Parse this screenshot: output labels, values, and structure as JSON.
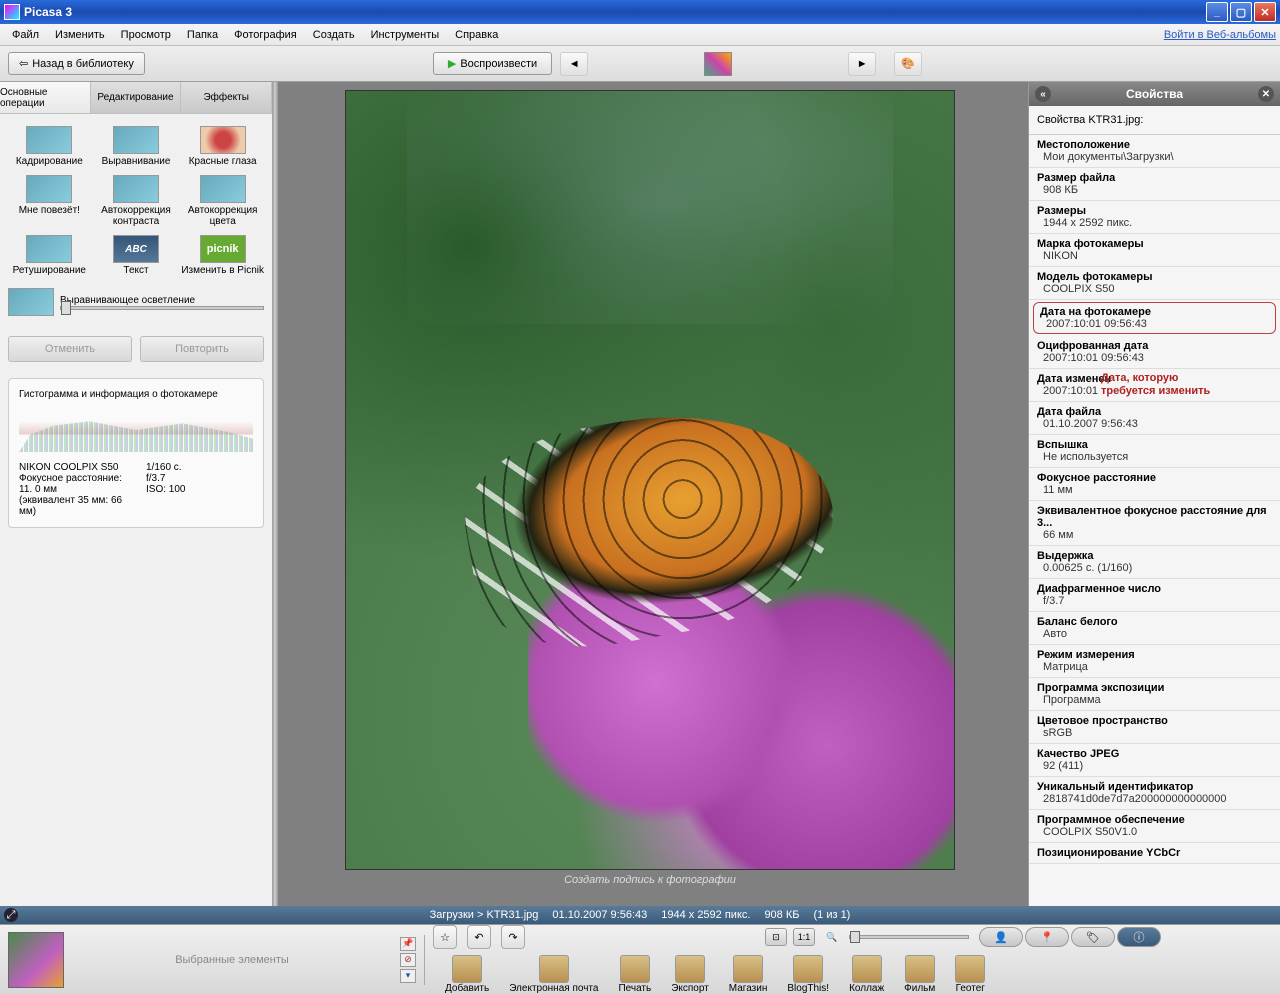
{
  "window": {
    "title": "Picasa 3"
  },
  "menu": {
    "items": [
      "Файл",
      "Изменить",
      "Просмотр",
      "Папка",
      "Фотография",
      "Создать",
      "Инструменты",
      "Справка"
    ],
    "login": "Войти в Веб-альбомы"
  },
  "toolbar": {
    "back": "Назад в библиотеку",
    "play": "Воспроизвести"
  },
  "tabs": {
    "basic": "Основные операции",
    "edit": "Редактирование",
    "effects": "Эффекты"
  },
  "tools": [
    "Кадрирование",
    "Выравнивание",
    "Красные глаза",
    "Мне повезёт!",
    "Автокоррекция контраста",
    "Автокоррекция цвета",
    "Ретуширование",
    "Текст",
    "Изменить в Picnik"
  ],
  "fill_light": "Выравнивающее осветление",
  "actions": {
    "undo": "Отменить",
    "redo": "Повторить"
  },
  "histogram": {
    "title": "Гистограмма и информация о фотокамере",
    "camera": "NIKON COOLPIX S50",
    "focal": "Фокусное расстояние: 11. 0 мм",
    "equiv": "(эквивалент 35 мм:  66 мм)",
    "shutter": "1/160 с.",
    "aperture": "f/3.7",
    "iso": "ISO: 100"
  },
  "caption_hint": "Создать подпись к фотографии",
  "properties": {
    "title": "Свойства",
    "subheader": "Свойства KTR31.jpg:",
    "items": [
      {
        "k": "Местоположение",
        "v": "Мои документы\\Загрузки\\"
      },
      {
        "k": "Размер файла",
        "v": "908 КБ"
      },
      {
        "k": "Размеры",
        "v": "1944 x 2592 пикс."
      },
      {
        "k": "Марка фотокамеры",
        "v": "NIKON"
      },
      {
        "k": "Модель фотокамеры",
        "v": "COOLPIX S50"
      },
      {
        "k": "Дата на фотокамере",
        "v": "2007:10:01 09:56:43",
        "hl": true
      },
      {
        "k": "Оцифрованная дата",
        "v": "2007:10:01 09:56:43"
      },
      {
        "k": "Дата изменен",
        "v": "2007:10:01"
      },
      {
        "k": "Дата файла",
        "v": "01.10.2007 9:56:43"
      },
      {
        "k": "Вспышка",
        "v": "Не используется"
      },
      {
        "k": "Фокусное расстояние",
        "v": "11 мм"
      },
      {
        "k": "Эквивалентное фокусное расстояние для 3...",
        "v": "66 мм"
      },
      {
        "k": "Выдержка",
        "v": "0.00625 с.  (1/160)"
      },
      {
        "k": "Диафрагменное число",
        "v": "f/3.7"
      },
      {
        "k": "Баланс белого",
        "v": "Авто"
      },
      {
        "k": "Режим измерения",
        "v": "Матрица"
      },
      {
        "k": "Программа экспозиции",
        "v": "Программа"
      },
      {
        "k": "Цветовое пространство",
        "v": "sRGB"
      },
      {
        "k": "Качество JPEG",
        "v": "92 (411)"
      },
      {
        "k": "Уникальный идентификатор",
        "v": "2818741d0de7d7a200000000000000"
      },
      {
        "k": "Программное обеспечение",
        "v": "COOLPIX S50V1.0"
      },
      {
        "k": "Позиционирование YCbCr",
        "v": ""
      }
    ],
    "annotation": "Дата, которую требуется изменить"
  },
  "status": {
    "path": "Загрузки > KTR31.jpg",
    "date": "01.10.2007 9:56:43",
    "dims": "1944 x 2592 пикс.",
    "size": "908 КБ",
    "pos": "(1 из 1)"
  },
  "tray": {
    "selected": "Выбранные элементы",
    "actions": [
      "Добавить",
      "Электронная почта",
      "Печать",
      "Экспорт",
      "Магазин",
      "BlogThis!",
      "Коллаж",
      "Фильм",
      "Геотег"
    ]
  }
}
